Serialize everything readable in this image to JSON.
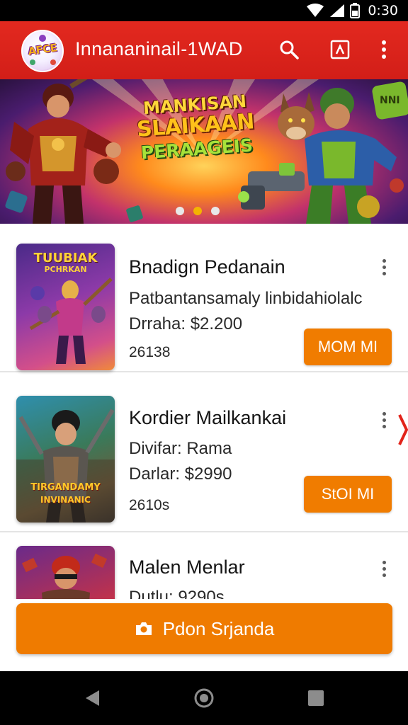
{
  "status_bar": {
    "time": "0:30"
  },
  "app_bar": {
    "logo_text": "AFCE",
    "title": "Innananinail-1WAD"
  },
  "banner": {
    "line1": "MANKISAN",
    "line2": "SLAIKAAN",
    "line3": "PERAAGEIS",
    "slides": 3,
    "active_slide": 2
  },
  "items": [
    {
      "title": "Bnadign Pedanain",
      "line1": "Patbantansamaly linbidahiolalc",
      "line2": "Drraha: $2.200",
      "meta": "26138",
      "button": "MOM MI",
      "thumb_text_top": "TUUBIAK",
      "thumb_text_sub": "PCHRKAN"
    },
    {
      "title": "Kordier Mailkankai",
      "line1": "Divifar: Rama",
      "line2": "Darlar: $2990",
      "meta": "2610s",
      "button": "StOI MI",
      "thumb_text_top": "TIRGANDAMY",
      "thumb_text_sub": "INVINANIC"
    },
    {
      "title": "Malen Menlar",
      "line1": "Dutlu: 9290s",
      "thumb_text_top": "",
      "thumb_text_sub": ""
    }
  ],
  "primary_action": {
    "label": "Pdon Srjanda"
  },
  "colors": {
    "app_bar": "#d21e18",
    "accent": "#ef7b00",
    "active_dot": "#f4b400"
  }
}
